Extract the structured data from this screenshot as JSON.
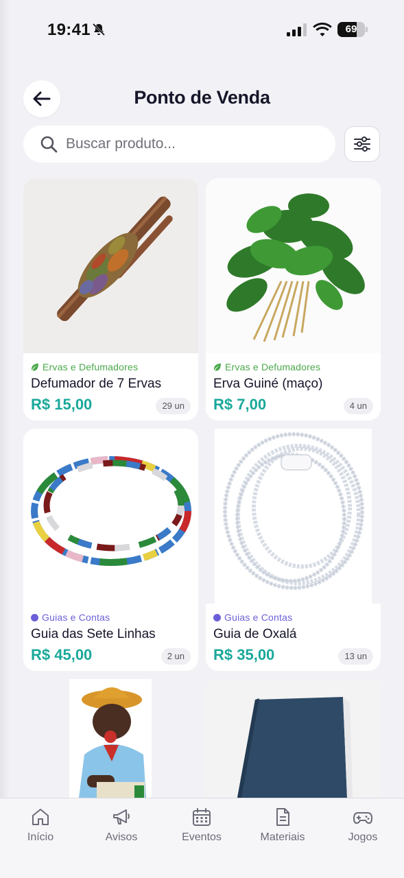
{
  "status_bar": {
    "time": "19:41",
    "battery": "69",
    "battery_level": 0.69
  },
  "header": {
    "title": "Ponto de Venda"
  },
  "search": {
    "placeholder": "Buscar produto..."
  },
  "colors": {
    "accent_price": "#1aa89a",
    "category_herbs": "#4aa84a",
    "category_guides": "#6b5fd8"
  },
  "products": [
    {
      "category": "Ervas e Defumadores",
      "category_icon": "leaf-icon",
      "name": "Defumador de 7 Ervas",
      "price": "R$ 15,00",
      "stock": "29 un"
    },
    {
      "category": "Ervas e Defumadores",
      "category_icon": "leaf-icon",
      "name": "Erva Guiné (maço)",
      "price": "R$ 7,00",
      "stock": "4 un"
    },
    {
      "category": "Guias e Contas",
      "category_icon": "dot-icon",
      "name": "Guia das Sete Linhas",
      "price": "R$ 45,00",
      "stock": "2 un"
    },
    {
      "category": "Guias e Contas",
      "category_icon": "dot-icon",
      "name": "Guia de Oxalá",
      "price": "R$ 35,00",
      "stock": "13 un"
    }
  ],
  "nav": [
    {
      "label": "Início",
      "icon": "home-icon"
    },
    {
      "label": "Avisos",
      "icon": "megaphone-icon"
    },
    {
      "label": "Eventos",
      "icon": "calendar-icon"
    },
    {
      "label": "Materiais",
      "icon": "document-icon"
    },
    {
      "label": "Jogos",
      "icon": "gamepad-icon"
    }
  ]
}
